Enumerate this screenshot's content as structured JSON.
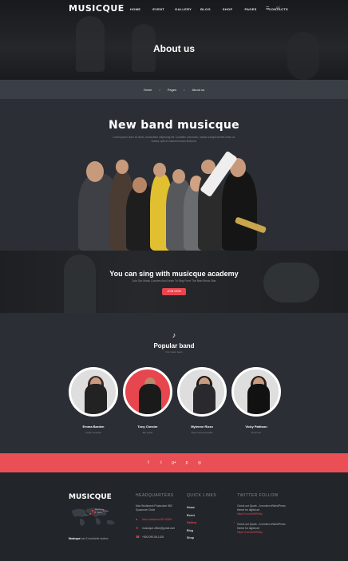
{
  "header": {
    "logo": "MUSICQUE",
    "menu": [
      "HOME",
      "EVENT",
      "GALLERY",
      "BLOG",
      "SHOP",
      "PAGES",
      "CONTACTS"
    ],
    "page_title": "About us"
  },
  "breadcrumb": {
    "items": [
      "Home",
      "Pages",
      "About us"
    ]
  },
  "band": {
    "title": "New band musicque",
    "subtitle": "Lorem ipsum dolor sit amet, consectetur adipiscing elit. Curabitur commodo, massa suscipit laoreet lorem ac massa, quis et massa rhoncus tincidunt."
  },
  "academy": {
    "title": "You can sing with musicque academy",
    "subtitle": "Join Our Music Courses And Learn To Sing From The Best Music Star",
    "button": "JOIN NOW"
  },
  "popular": {
    "title": "Popular band",
    "subtitle": "Our music team",
    "members": [
      {
        "name": "Emma Barden",
        "role": "Vocal musician",
        "bg": "#dedede"
      },
      {
        "name": "Tony Chester",
        "role": "Bet guitar",
        "bg": "#e8464e"
      },
      {
        "name": "Mylenne Rizzo",
        "role": "Flute instrumentalist",
        "bg": "#dedede"
      },
      {
        "name": "Vicky Pattison",
        "role": "Drummer",
        "bg": "#dedede"
      }
    ]
  },
  "social": {
    "icons": [
      "f",
      "t",
      "g+",
      "p",
      "◎"
    ]
  },
  "footer": {
    "logo": "MUSICQUE",
    "map_caption_bold": "Musicque",
    "map_caption": "has 5 worldwide studios",
    "map_labels": [
      "Manchester",
      "Berlin",
      "Paris",
      "Mos"
    ],
    "hq_title": "HEADQUARTERS",
    "hq_address": "Max Wodkneck Production 982 Sycamore Circle",
    "hq_phone": "New caledonia,NE 90200",
    "hq_email": "musicque.office@gmail.com",
    "hq_tel": "+800-090-56-1426",
    "links_title": "QUICK LINKS",
    "links": [
      "Home",
      "Event",
      "Gallery",
      "Blog",
      "Shop"
    ],
    "twitter_title": "TWITTER FOLLOW",
    "tweets": [
      {
        "text": "Check out Quark - A modern #WordPress theme for digital art",
        "link": "https://t.co/sx0M9nNy"
      },
      {
        "text": "Check out Quark - A modern #WordPress theme for digital art",
        "link": "https://t.co/sx0M9nNy"
      }
    ]
  }
}
